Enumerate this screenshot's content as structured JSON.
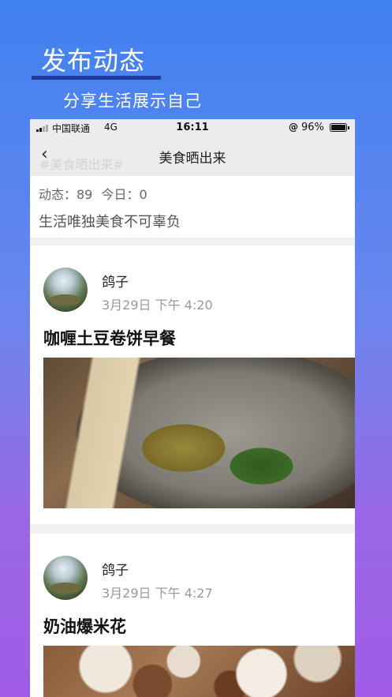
{
  "promo": {
    "title": "发布动态",
    "subtitle": "分享生活展示自己"
  },
  "status_bar": {
    "carrier": "中国联通",
    "network": "4G",
    "time": "16:11",
    "battery": "96%"
  },
  "nav": {
    "title": "美食晒出来",
    "ghost_tag": "#美食晒出来#"
  },
  "topic": {
    "stats_posts": "动态：89",
    "stats_today": "今日：0",
    "description": "生活唯独美食不可辜负"
  },
  "posts": [
    {
      "author": "鸽子",
      "time": "3月29日 下午 4:20",
      "title": "咖喱土豆卷饼早餐"
    },
    {
      "author": "鸽子",
      "time": "3月29日 下午 4:27",
      "title": "奶油爆米花"
    }
  ]
}
